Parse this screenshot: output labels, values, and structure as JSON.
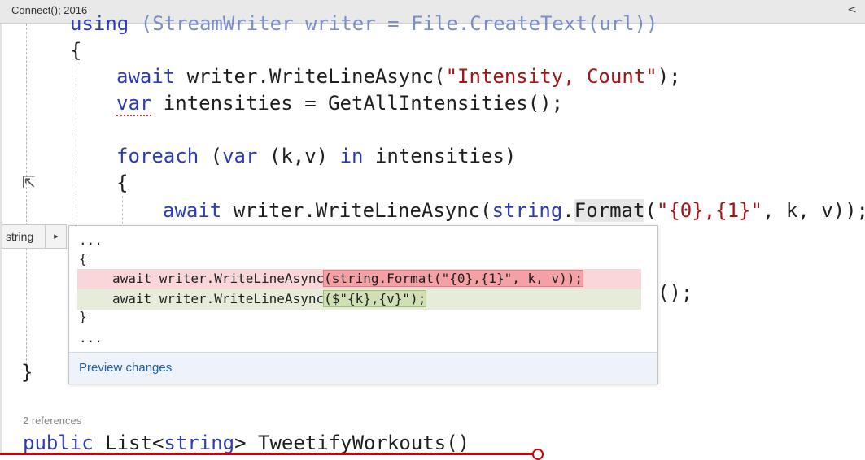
{
  "top_bar": {
    "title": "Connect(); 2016",
    "share_icon_glyph": "<"
  },
  "code_lines": {
    "l0": {
      "kw1": "using",
      "rest": " (StreamWriter writer = File.CreateText(url))"
    },
    "l1": "{",
    "l2": {
      "kw": "await",
      "a": " writer.WriteLineAsync(",
      "str": "\"Intensity, Count\"",
      "b": ");"
    },
    "l3": {
      "kw": "var",
      "rest": " intensities = GetAllIntensities();"
    },
    "l4": {
      "kw1": "foreach",
      "a": " (",
      "kw2": "var",
      "b": " (k,v) ",
      "kw3": "in",
      "c": " intensities)"
    },
    "l5": "{",
    "l6": {
      "kw": "await",
      "a": " writer.WriteLineAsync(",
      "kw2": "string",
      "b": ".",
      "fmt": "Format",
      "c": "(",
      "str": "\"{0},{1}\"",
      "d": ", k, v));"
    },
    "l7_tail": "();",
    "l8": "}"
  },
  "peek_tag": {
    "label": "string",
    "arrow": "▸"
  },
  "preview": {
    "ellipsis_top": "...",
    "brace_open": "{",
    "del_line": {
      "a": "await writer.WriteLineAsyn",
      "b": "c",
      "c": "(string.Format(\"{0},{1}\", k, v));"
    },
    "add_line": {
      "a": "await writer.WriteLineAsyn",
      "b": "c",
      "c": "($\"{k},{v}\");"
    },
    "brace_close": "}",
    "ellipsis_bottom": "...",
    "footer_link": "Preview changes"
  },
  "references": "2 references",
  "method_sig": {
    "kw": "public",
    "a": " List<",
    "kw2": "string",
    "b": "> TweetifyWorkouts()"
  },
  "colors": {
    "keyword": "#2c3bb4",
    "string": "#a31515",
    "deleted": "#f3a1a4",
    "added": "#d1e0b4",
    "link": "#1e5fa8",
    "progress": "#d00000"
  }
}
